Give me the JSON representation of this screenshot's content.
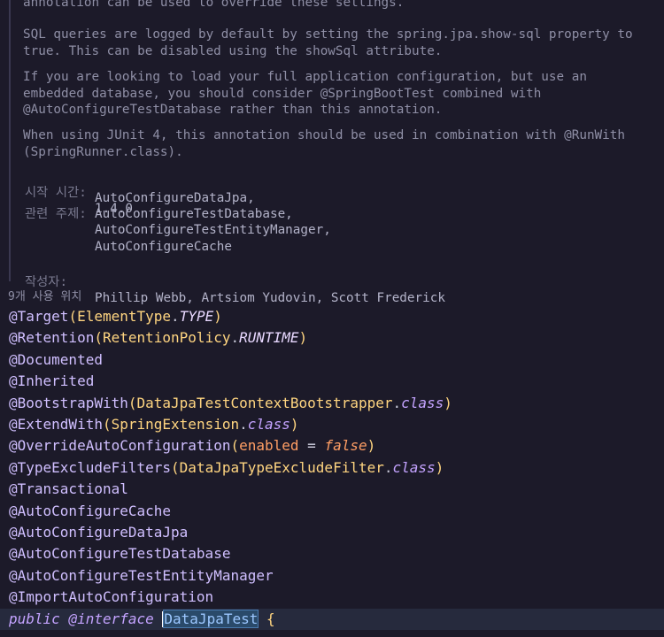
{
  "doc": {
    "paragraphs": [
      {
        "lines": [
          "annotation can be used to override these settings."
        ]
      },
      {
        "lines": [
          "SQL queries are logged by default by setting the spring.jpa.show-sql property to",
          "true. This can be disabled using the showSql attribute."
        ]
      },
      {
        "lines": [
          "If you are looking to load your full application configuration, but use an",
          "embedded database, you should consider @SpringBootTest combined with",
          "@AutoConfigureTestDatabase rather than this annotation."
        ]
      },
      {
        "lines": [
          "When using JUnit 4, this annotation should be used in combination with @RunWith",
          "(SpringRunner.class)."
        ]
      }
    ],
    "tags": {
      "since_label": "시작 시간:",
      "since_value": "1.4.0",
      "see_label": "관련 주제:",
      "see_values": [
        "AutoConfigureDataJpa,",
        "AutoConfigureTestDatabase,",
        "AutoConfigureTestEntityManager,",
        "AutoConfigureCache"
      ],
      "author_label": "작성자:",
      "author_value": "Phillip Webb, Artsiom Yudovin, Scott Frederick"
    }
  },
  "usages_hint": "9개 사용 위치",
  "code": {
    "l1_ann": "@Target",
    "l1_open": "(",
    "l1_cls": "ElementType",
    "l1_dot": ".",
    "l1_enum": "TYPE",
    "l1_close": ")",
    "l2_ann": "@Retention",
    "l2_open": "(",
    "l2_cls": "RetentionPolicy",
    "l2_dot": ".",
    "l2_enum": "RUNTIME",
    "l2_close": ")",
    "l3_ann": "@Documented",
    "l4_ann": "@Inherited",
    "l5_ann": "@BootstrapWith",
    "l5_open": "(",
    "l5_cls": "DataJpaTestContextBootstrapper",
    "l5_dot": ".",
    "l5_kw": "class",
    "l5_close": ")",
    "l6_ann": "@ExtendWith",
    "l6_open": "(",
    "l6_cls": "SpringExtension",
    "l6_dot": ".",
    "l6_kw": "class",
    "l6_close": ")",
    "l7_ann": "@OverrideAutoConfiguration",
    "l7_open": "(",
    "l7_param": "enabled",
    "l7_eq": " = ",
    "l7_bool": "false",
    "l7_close": ")",
    "l8_ann": "@TypeExcludeFilters",
    "l8_open": "(",
    "l8_cls": "DataJpaTypeExcludeFilter",
    "l8_dot": ".",
    "l8_kw": "class",
    "l8_close": ")",
    "l9_ann": "@Transactional",
    "l10_ann": "@AutoConfigureCache",
    "l11_ann": "@AutoConfigureDataJpa",
    "l12_ann": "@AutoConfigureTestDatabase",
    "l13_ann": "@AutoConfigureTestEntityManager",
    "l14_ann": "@ImportAutoConfiguration",
    "l15_kw1": "public",
    "l15_kw2": "@interface",
    "l15_name": "DataJpaTest",
    "l15_brace": "{"
  },
  "colors": {
    "background": "#1c1a29",
    "annotation": "#d0bfff",
    "class": "#ffd580",
    "keyword": "#c4a3ff",
    "parameter": "#ff9e64",
    "doc_text": "#8f8fa6",
    "current_line": "#262a3d"
  }
}
